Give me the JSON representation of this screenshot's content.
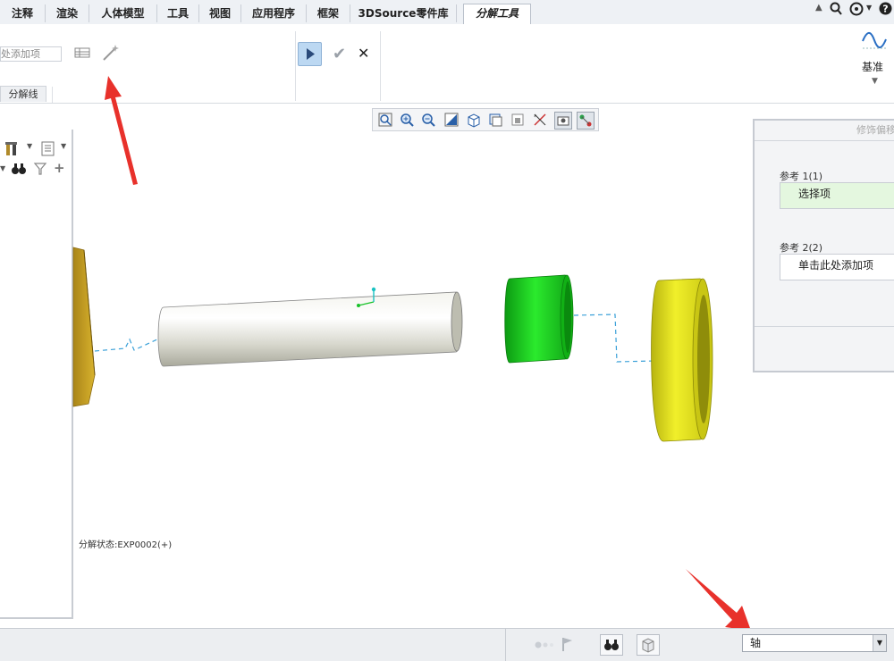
{
  "tabs": [
    {
      "label": "注释"
    },
    {
      "label": "渲染"
    },
    {
      "label": "人体模型"
    },
    {
      "label": "工具"
    },
    {
      "label": "视图"
    },
    {
      "label": "应用程序"
    },
    {
      "label": "框架"
    },
    {
      "label": "3DSource零件库"
    },
    {
      "label": "分解工具",
      "active": true
    }
  ],
  "ribbon": {
    "reference_field_value": "处添加项",
    "group_label": "分解线",
    "datum_label": "基准"
  },
  "dialog": {
    "title": "修饰偏移",
    "ref1_label": "参考 1(1)",
    "ref1_value": "选择项",
    "ref2_label": "参考 2(2)",
    "ref2_value": "单击此处添加项",
    "ref1_color": "#e4f7df"
  },
  "status": {
    "explode_state": "分解状态:EXP0002(+)"
  },
  "bottombar": {
    "filter_value": "轴"
  },
  "icons": {
    "play": "play-icon",
    "check": "check-icon",
    "close": "close-icon",
    "wand": "magic-wand-icon",
    "datum": "datum-curve-icon"
  },
  "colors": {
    "annotation_arrow": "#e8312b",
    "shaft": "#dcdcd2",
    "green_bushing": "#18c81a",
    "yellow_ring": "#e3e21a",
    "gold_part": "#c9a423",
    "explode_line": "#3aa0d8"
  }
}
